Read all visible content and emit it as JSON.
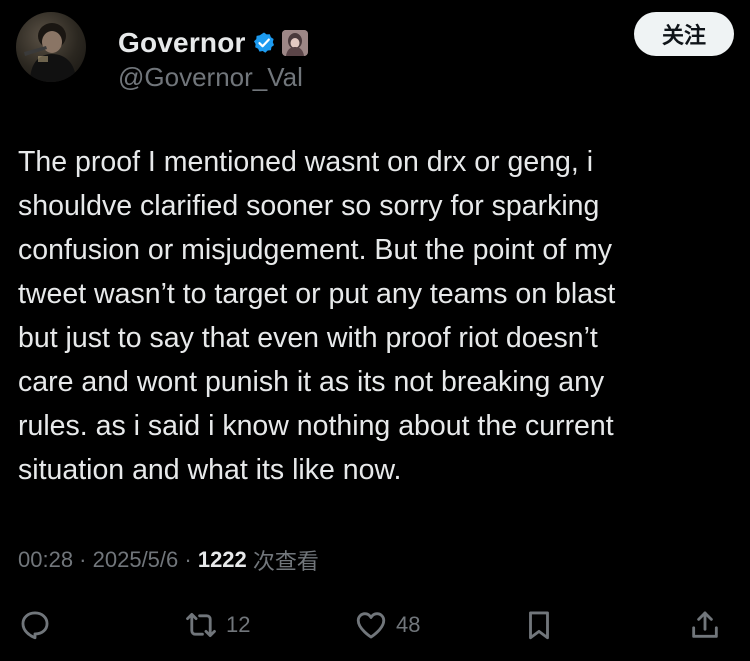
{
  "author": {
    "display_name": "Governor",
    "handle": "@Governor_Val",
    "verified": true
  },
  "follow_button": {
    "label": "关注"
  },
  "tweet": {
    "text": "The proof I mentioned wasnt on drx or geng, i\nshouldve clarified sooner so sorry for sparking\nconfusion or misjudgement. But the point of my\ntweet wasn’t to target or put any teams on blast\nbut just to say that even with proof riot doesn’t\ncare and wont punish it as its not breaking any\nrules. as i said i know nothing about the current\nsituation and what its like now."
  },
  "meta": {
    "time": "00:28",
    "separator": " · ",
    "date": "2025/5/6",
    "views_count": "1222",
    "views_label": " 次查看"
  },
  "actions": {
    "reply_count": "",
    "retweet_count": "12",
    "like_count": "48"
  },
  "colors": {
    "background": "#000000",
    "text_primary": "#e7e9ea",
    "text_secondary": "#71767b",
    "verified_blue": "#1d9bf0",
    "follow_bg": "#eff3f4"
  }
}
